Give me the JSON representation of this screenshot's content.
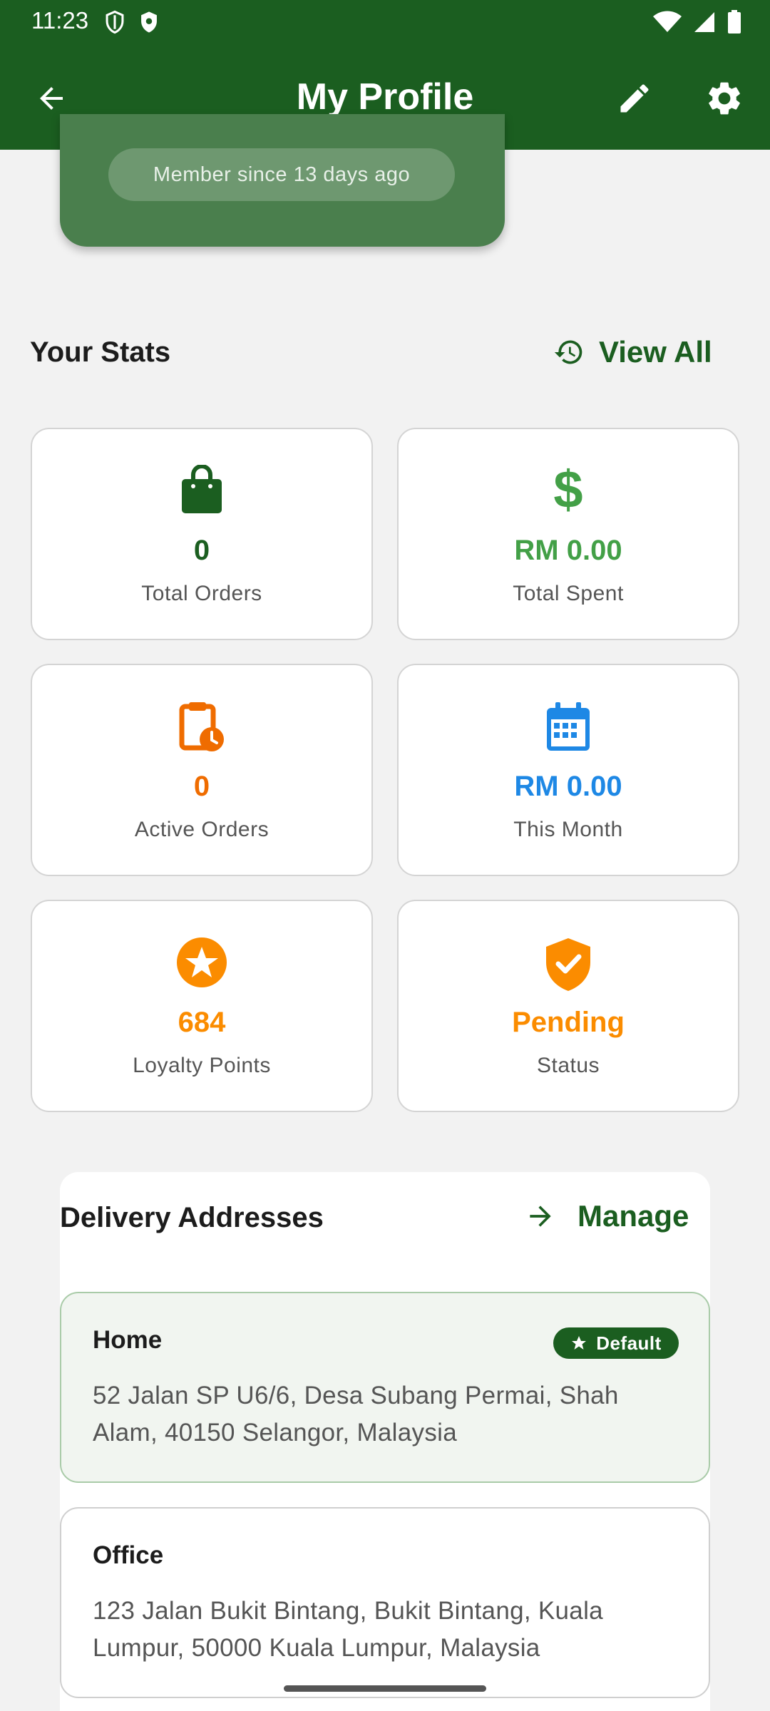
{
  "status_bar": {
    "time": "11:23"
  },
  "app_bar": {
    "title": "My Profile"
  },
  "profile": {
    "member_since": "Member since 13 days ago"
  },
  "stats": {
    "title": "Your Stats",
    "view_all": "View All",
    "cards": [
      {
        "value": "0",
        "label": "Total Orders",
        "icon": "shopping-bag-icon",
        "color": "#1b5e20"
      },
      {
        "value": "RM 0.00",
        "label": "Total Spent",
        "icon": "dollar-icon",
        "color": "#43a047"
      },
      {
        "value": "0",
        "label": "Active Orders",
        "icon": "pending-actions-icon",
        "color": "#ef6c00"
      },
      {
        "value": "RM 0.00",
        "label": "This Month",
        "icon": "calendar-icon",
        "color": "#1e88e5"
      },
      {
        "value": "684",
        "label": "Loyalty Points",
        "icon": "star-icon",
        "color": "#fb8c00"
      },
      {
        "value": "Pending",
        "label": "Status",
        "icon": "verified-shield-icon",
        "color": "#fb8c00"
      }
    ]
  },
  "addresses": {
    "title": "Delivery Addresses",
    "manage": "Manage",
    "default_badge": "Default",
    "items": [
      {
        "name": "Home",
        "address": "52 Jalan SP U6/6, Desa Subang Permai, Shah Alam, 40150 Selangor, Malaysia"
      },
      {
        "name": "Office",
        "address": "123 Jalan Bukit Bintang, Bukit Bintang, Kuala Lumpur, 50000 Kuala Lumpur, Malaysia"
      }
    ]
  },
  "colors": {
    "primary": "#1b5e20",
    "card_green": "#4a7f4d"
  }
}
